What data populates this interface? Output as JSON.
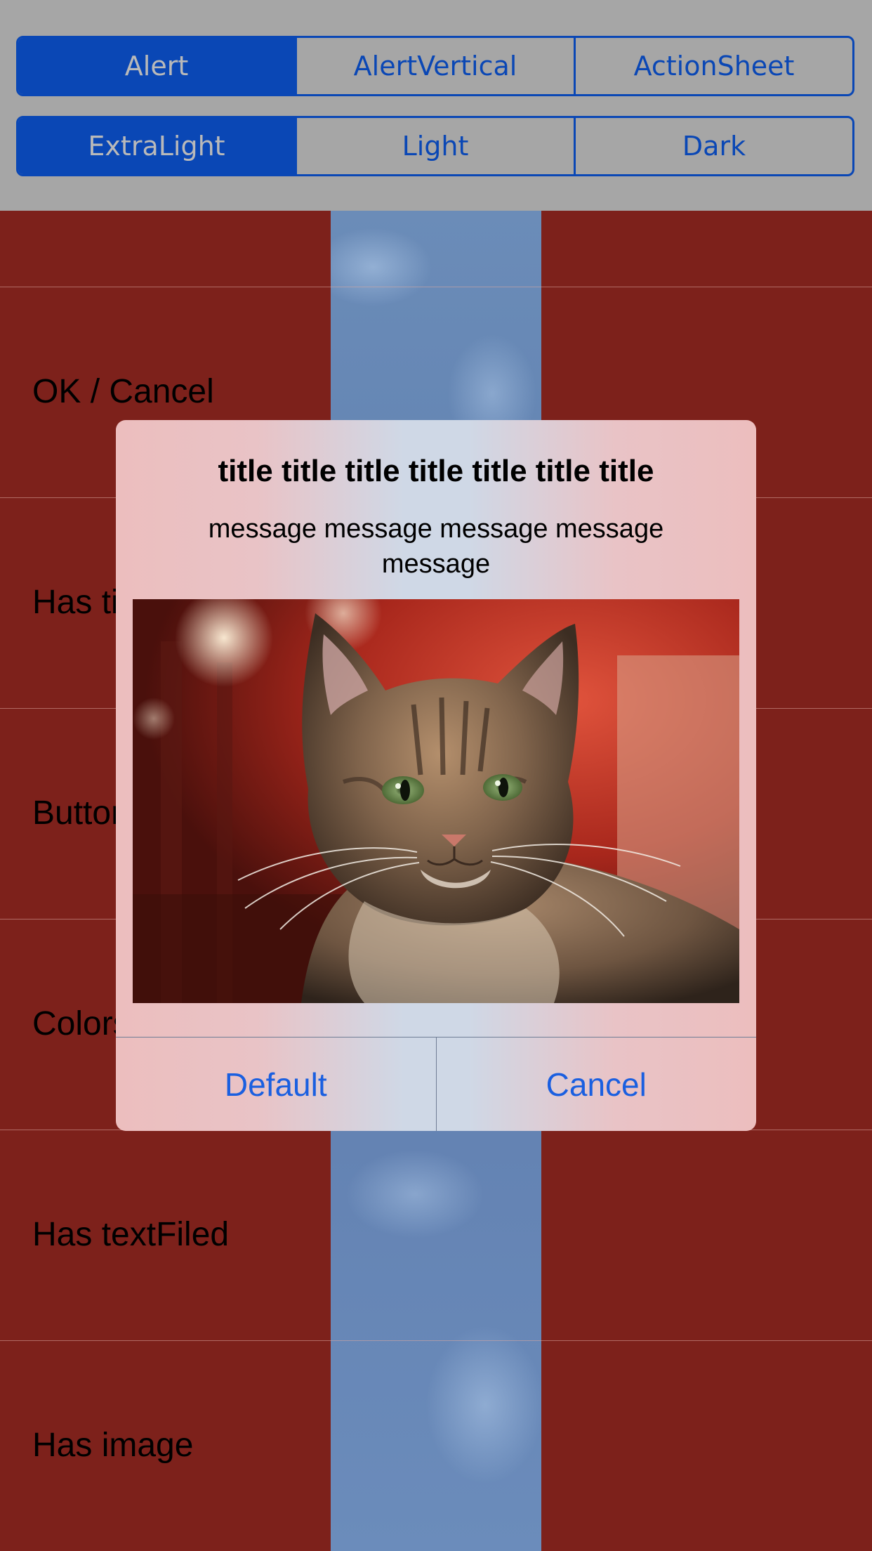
{
  "segments": {
    "style_row": [
      "Alert",
      "AlertVertical",
      "ActionSheet"
    ],
    "style_selected": "Alert",
    "blur_row": [
      "ExtraLight",
      "Light",
      "Dark"
    ],
    "blur_selected": "ExtraLight"
  },
  "table": {
    "rows": [
      {
        "label": ""
      },
      {
        "label": "OK / Cancel"
      },
      {
        "label": "Has title"
      },
      {
        "label": "Buttons"
      },
      {
        "label": "Colors"
      },
      {
        "label": "Has textFiled"
      },
      {
        "label": "Has image"
      }
    ]
  },
  "alert": {
    "title": "title title title title title title title",
    "message": "message message message message message",
    "image_subject": "tabby cat photo",
    "buttons": [
      "Default",
      "Cancel"
    ]
  },
  "colors": {
    "accent": "#0a47b5",
    "button_text": "#1a5fe0",
    "row_background": "#7d211b",
    "header_background": "#a6a6a6"
  }
}
